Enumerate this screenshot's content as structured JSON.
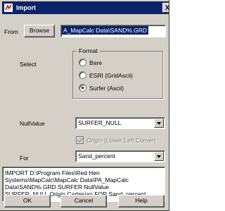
{
  "window": {
    "title": "Import",
    "close_label": "X"
  },
  "from": {
    "label": "From",
    "browse_label": "Browse",
    "path_value": "A_MapCalc Data\\SAND%.GRD"
  },
  "select_label": "Select",
  "format": {
    "title": "Format",
    "options": [
      {
        "label": "Bare",
        "selected": false
      },
      {
        "label": "ESRI (GridAscii)",
        "selected": false
      },
      {
        "label": "Surfer (Ascii)",
        "selected": true
      }
    ]
  },
  "nullvalue": {
    "label": "NullValue",
    "value": "SURFER_NULL"
  },
  "origin_checkbox": {
    "label": "Origin (Lower Left Corner)",
    "checked": true,
    "disabled": true
  },
  "for": {
    "label": "For",
    "value": "Sand_percent"
  },
  "command_lines": [
    "IMPORT D:\\Program Files\\Red Hen",
    "Systems\\MapCalc\\MapCalc Data\\PA_MapCalc",
    "Data\\SAND%.GRD SURFER NullValue",
    "SURFER_NULL Origin Cartesian FOR Sand_percent"
  ],
  "buttons": {
    "ok": "OK",
    "cancel": "Cancel",
    "help": "Help"
  },
  "colors": {
    "titlebar": "#0a246a",
    "face": "#d4d0c8",
    "highlight": "#0a246a"
  }
}
